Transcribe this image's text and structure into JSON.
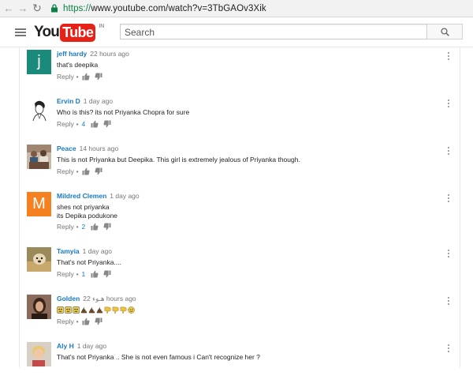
{
  "browser": {
    "url_scheme": "https://",
    "url_rest": "www.youtube.com/watch?v=3TbGAOv3Xik"
  },
  "header": {
    "logo_you": "You",
    "logo_tube": "Tube",
    "logo_country": "IN",
    "search_placeholder": "Search"
  },
  "comments": [
    {
      "author": "jeff hardy",
      "time": "22 hours ago",
      "text": "that's deepika",
      "reply": "Reply",
      "likes": "",
      "avatar": {
        "type": "letter",
        "letter": "j",
        "color": "#1a8a7a"
      }
    },
    {
      "author": "Ervin D",
      "time": "1 day ago",
      "text": "Who is this? its not Priyanka Chopra  for sure",
      "reply": "Reply",
      "likes": "4",
      "avatar": {
        "type": "image",
        "icon": "sketch-portrait-avatar"
      }
    },
    {
      "author": "Peace",
      "time": "14 hours ago",
      "text": "This is not Priyanka but Deepika. This girl is extremely jealous of Priyanka though.",
      "reply": "Reply",
      "likes": "",
      "avatar": {
        "type": "image",
        "icon": "group-photo-avatar"
      }
    },
    {
      "author": "Mildred Clemen",
      "time": "1 day ago",
      "text": "shes not priyanka\nits Depika podukone",
      "reply": "Reply",
      "likes": "2",
      "avatar": {
        "type": "letter",
        "letter": "M",
        "color": "#f4801f"
      }
    },
    {
      "author": "Tamyia",
      "time": "1 day ago",
      "text": "That's not Priyanka....",
      "reply": "Reply",
      "likes": "1",
      "avatar": {
        "type": "image",
        "icon": "dog-photo-avatar"
      }
    },
    {
      "author": "Golden",
      "time": "22 هـوء hours ago",
      "text": "",
      "reply": "Reply",
      "likes": "",
      "avatar": {
        "type": "image",
        "icon": "woman-photo-avatar"
      }
    },
    {
      "author": "Aly H",
      "time": "1 day ago",
      "text": "That's not Priyanka .. She is not even famous i Can't recognize her ?",
      "reply": "Reply",
      "likes": "",
      "avatar": {
        "type": "image",
        "icon": "child-photo-avatar"
      }
    }
  ],
  "colors": {
    "author_link": "#167ac6",
    "youtube_red": "#e62117"
  }
}
